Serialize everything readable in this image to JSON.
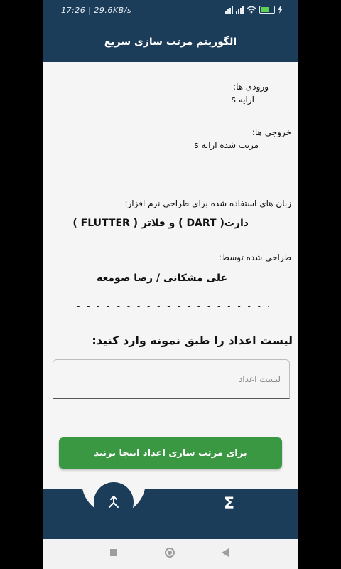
{
  "status_bar": {
    "time": "17:26 | 29.6KB/s"
  },
  "app_bar": {
    "title": "الگوریتم مرتب سازی سریع"
  },
  "info": {
    "inputs_label": "ورودی ها:",
    "inputs_value": "آرایه s",
    "outputs_label": "خروجی ها:",
    "outputs_value": "مرتب شده ارایه s",
    "divider": "- - - - - - - - - - - - - - - - - - - - - - - - - - - - -",
    "languages_label": "زبان های استفاده شده برای طراحی نرم افزار:",
    "languages_value": "دارت( DART ) و فلاتر ( FLUTTER )",
    "designed_by_label": "طراحی شده توسط:",
    "designed_by_value": "علی مشکانی / رضا صومعه"
  },
  "form": {
    "prompt": "لیست اعداد را طبق نمونه وارد کنید:",
    "input_placeholder": "لیست اعداد",
    "input_value": "",
    "sort_button": "برای مرتب سازی اعداد اینجا بزنید"
  },
  "bottom_nav": {
    "sigma_glyph": "Σ",
    "fab_icon": "merge-icon"
  },
  "colors": {
    "primary": "#1c3d5a",
    "button": "#3b9842",
    "background": "#f5f5f5"
  }
}
